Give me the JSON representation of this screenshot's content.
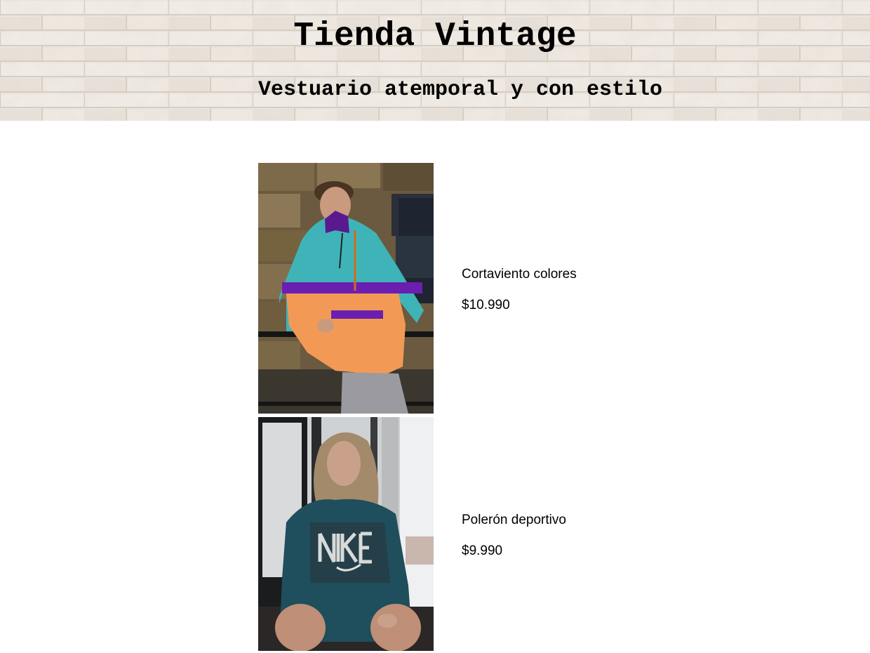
{
  "header": {
    "title": "Tienda Vintage",
    "subtitle": "Vestuario atemporal y con estilo"
  },
  "products": [
    {
      "name": "Cortaviento colores",
      "price": "$10.990",
      "photo_alt": "Cortaviento colores",
      "colors": [
        "#3fb4b8",
        "#f29a55",
        "#6b1fb0"
      ]
    },
    {
      "name": "Polerón deportivo",
      "price": "$9.990",
      "photo_alt": "Polerón deportivo",
      "colors": [
        "#1f4e5c",
        "#2a2a2a"
      ]
    }
  ]
}
